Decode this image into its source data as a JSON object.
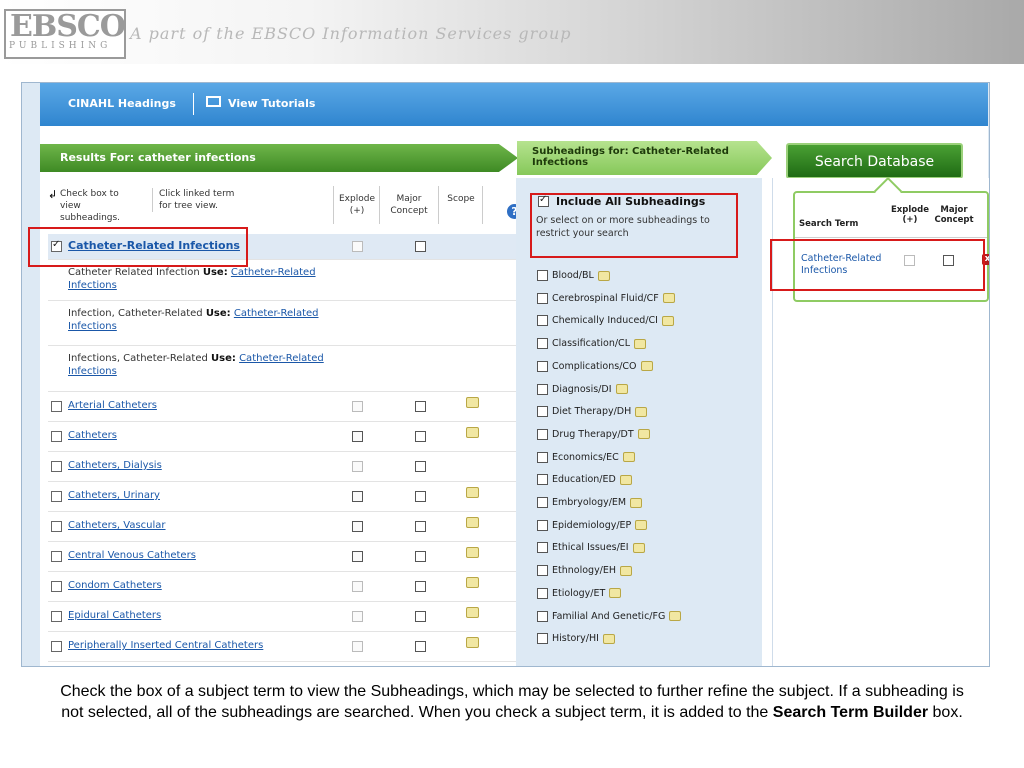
{
  "banner": {
    "logo_main": "EBSCO",
    "logo_sub": "PUBLISHING",
    "tagline": "A part of the EBSCO Information Services group"
  },
  "topbar": {
    "cinahl_label": "CINAHL Headings",
    "tutorials_label": "View Tutorials"
  },
  "results": {
    "header": "Results For: catheter infections",
    "hint_checkbox": "Check box to view subheadings.",
    "hint_link": "Click linked term for tree view.",
    "col_explode": "Explode (+)",
    "col_major": "Major Concept",
    "col_scope": "Scope",
    "selected_term": "Catheter-Related Infections",
    "use_rows": [
      {
        "text": "Catheter Related Infection",
        "use": "Use:",
        "link": "Catheter-Related Infections"
      },
      {
        "text": "Infection, Catheter-Related",
        "use": "Use:",
        "link": "Catheter-Related Infections"
      },
      {
        "text": "Infections, Catheter-Related",
        "use": "Use:",
        "link": "Catheter-Related Infections"
      }
    ],
    "terms": [
      {
        "label": "Arterial Catheters",
        "explode_enabled": false,
        "scope": true
      },
      {
        "label": "Catheters",
        "explode_enabled": true,
        "scope": true
      },
      {
        "label": "Catheters, Dialysis",
        "explode_enabled": false,
        "scope": false
      },
      {
        "label": "Catheters, Urinary",
        "explode_enabled": true,
        "scope": true
      },
      {
        "label": "Catheters, Vascular",
        "explode_enabled": true,
        "scope": true
      },
      {
        "label": "Central Venous Catheters",
        "explode_enabled": true,
        "scope": true
      },
      {
        "label": "Condom Catheters",
        "explode_enabled": false,
        "scope": true
      },
      {
        "label": "Epidural Catheters",
        "explode_enabled": false,
        "scope": true
      },
      {
        "label": "Peripherally Inserted Central Catheters",
        "explode_enabled": false,
        "scope": true
      }
    ]
  },
  "subheadings": {
    "header": "Subheadings for: Catheter-Related Infections",
    "include_all": "Include All Subheadings",
    "include_desc": "Or select on or more subheadings to restrict your search",
    "items": [
      "Blood/BL",
      "Cerebrospinal Fluid/CF",
      "Chemically Induced/CI",
      "Classification/CL",
      "Complications/CO",
      "Diagnosis/DI",
      "Diet Therapy/DH",
      "Drug Therapy/DT",
      "Economics/EC",
      "Education/ED",
      "Embryology/EM",
      "Epidemiology/EP",
      "Ethical Issues/EI",
      "Ethnology/EH",
      "Etiology/ET",
      "Familial And Genetic/FG",
      "History/HI"
    ]
  },
  "builder": {
    "search_button": "Search Database",
    "col_term": "Search Term",
    "col_explode": "Explode (+)",
    "col_major": "Major Concept",
    "term": "Catheter-Related Infections",
    "delete": "x"
  },
  "caption": {
    "part1": "Check the box of a subject term to view the Subheadings, which may be selected to further refine the subject. If a subheading is not selected, all of the subheadings are searched. When you check a subject term, it is added to the ",
    "bold": "Search Term Builder",
    "part2": " box."
  },
  "colors": {
    "topbar_blue": "#2f85cf",
    "results_green": "#3e8a24",
    "link_blue": "#1a57a8",
    "highlight_red": "#d71a1a"
  }
}
